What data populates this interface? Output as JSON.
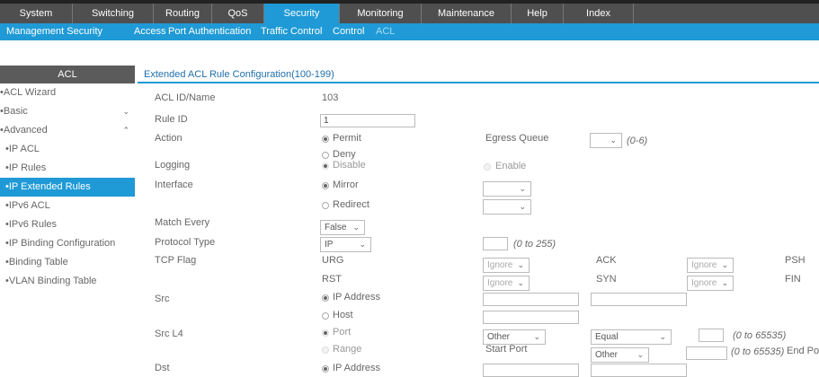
{
  "topnav": [
    "System",
    "Switching",
    "Routing",
    "QoS",
    "Security",
    "Monitoring",
    "Maintenance",
    "Help",
    "Index"
  ],
  "subnav": [
    "Management Security",
    "Access",
    "Port Authentication",
    "Traffic Control",
    "Control",
    "ACL"
  ],
  "sidebar": {
    "title": "ACL",
    "items": [
      "ACL Wizard",
      "Basic",
      "Advanced",
      "IP ACL",
      "IP Rules",
      "IP Extended Rules",
      "IPv6 ACL",
      "IPv6 Rules",
      "IP Binding Configuration",
      "Binding Table",
      "VLAN Binding Table"
    ]
  },
  "form": {
    "title": "Extended ACL Rule Configuration(100-199)",
    "labels": {
      "acl_id": "ACL ID/Name",
      "rule_id": "Rule ID",
      "action": "Action",
      "logging": "Logging",
      "interface": "Interface",
      "match_every": "Match Every",
      "protocol_type": "Protocol Type",
      "tcp_flag": "TCP Flag",
      "src": "Src",
      "src_l4": "Src L4",
      "dst": "Dst",
      "egress_queue": "Egress Queue",
      "start_port": "Start Port",
      "end_port": "End Por"
    },
    "acl_id_value": "103",
    "rule_id_value": "1",
    "action_options": [
      "Permit",
      "Deny"
    ],
    "logging_options": [
      "Disable",
      "Enable"
    ],
    "interface_options": [
      "Mirror",
      "Redirect"
    ],
    "match_every_value": "False",
    "protocol_value": "IP",
    "egress_hint": "(0-6)",
    "protocol_hint": "(0 to 255)",
    "tcp_flags": [
      "URG",
      "ACK",
      "PSH",
      "RST",
      "SYN",
      "FIN"
    ],
    "ignore": "Ignore",
    "src_options": [
      "IP Address",
      "Host"
    ],
    "src_l4_options": [
      "Port",
      "Range"
    ],
    "port_value": "Other",
    "operator_value": "Equal",
    "port_hint": "(0 to 65535)",
    "dst_options": [
      "IP Address"
    ]
  }
}
